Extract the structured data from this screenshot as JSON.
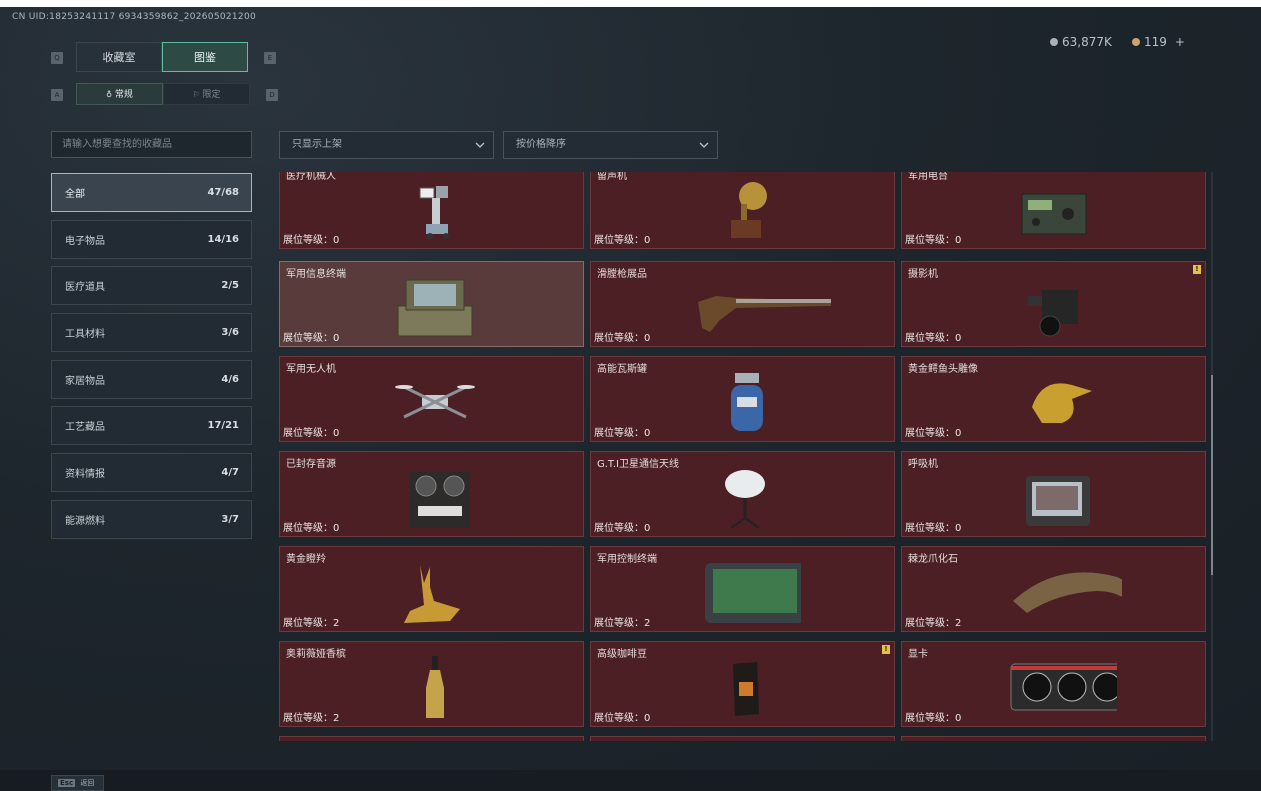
{
  "uid": "CN UID:18253241117 6934359862_202605021200",
  "currency": {
    "coins": "63,877K",
    "tokens": "119",
    "tokens_add": "+"
  },
  "keys": {
    "q": "Q",
    "e": "E",
    "a": "A",
    "d": "D"
  },
  "tabs": [
    "收藏室",
    "图鉴"
  ],
  "subtabs": [
    "常规",
    "限定"
  ],
  "search": {
    "placeholder": "请输入想要查找的收藏品"
  },
  "filters": {
    "shelf": "只显示上架",
    "sort": "按价格降序"
  },
  "categories": [
    {
      "label": "全部",
      "count": "47/68"
    },
    {
      "label": "电子物品",
      "count": "14/16"
    },
    {
      "label": "医疗道具",
      "count": "2/5"
    },
    {
      "label": "工具材料",
      "count": "3/6"
    },
    {
      "label": "家居物品",
      "count": "4/6"
    },
    {
      "label": "工艺藏品",
      "count": "17/21"
    },
    {
      "label": "资料情报",
      "count": "4/7"
    },
    {
      "label": "能源燃料",
      "count": "3/7"
    }
  ],
  "items": [
    {
      "name": "医疗机械人",
      "level": "展位等级：0",
      "icon": "medical-robot-icon"
    },
    {
      "name": "留声机",
      "level": "展位等级：0",
      "icon": "gramophone-icon"
    },
    {
      "name": "军用电台",
      "level": "展位等级：0",
      "icon": "radio-icon"
    },
    {
      "name": "军用信息终端",
      "level": "展位等级：0",
      "icon": "terminal-case-icon"
    },
    {
      "name": "滑膛枪展品",
      "level": "展位等级：0",
      "icon": "musket-icon"
    },
    {
      "name": "摄影机",
      "level": "展位等级：0",
      "icon": "camera-icon"
    },
    {
      "name": "军用无人机",
      "level": "展位等级：0",
      "icon": "drone-icon"
    },
    {
      "name": "高能瓦斯罐",
      "level": "展位等级：0",
      "icon": "gas-canister-icon"
    },
    {
      "name": "黄金鳄鱼头雕像",
      "level": "展位等级：0",
      "icon": "croc-statue-icon"
    },
    {
      "name": "已封存音源",
      "level": "展位等级：0",
      "icon": "reel-recorder-icon"
    },
    {
      "name": "G.T.I卫星通信天线",
      "level": "展位等级：0",
      "icon": "satellite-dish-icon"
    },
    {
      "name": "呼吸机",
      "level": "展位等级：0",
      "icon": "ventilator-icon"
    },
    {
      "name": "黄金瞪羚",
      "level": "展位等级：2",
      "icon": "gazelle-icon"
    },
    {
      "name": "军用控制终端",
      "level": "展位等级：2",
      "icon": "control-terminal-icon"
    },
    {
      "name": "棘龙爪化石",
      "level": "展位等级：2",
      "icon": "claw-fossil-icon"
    },
    {
      "name": "奥莉薇娅香槟",
      "level": "展位等级：2",
      "icon": "champagne-icon"
    },
    {
      "name": "高级咖啡豆",
      "level": "展位等级：0",
      "icon": "coffee-bag-icon"
    },
    {
      "name": "显卡",
      "level": "展位等级：0",
      "icon": "gpu-icon"
    }
  ],
  "alerts": {
    "mark": "!"
  },
  "footer": {
    "esc_key": "Esc",
    "esc_label": "返回"
  },
  "colors": {
    "accent": "#5fbfa0",
    "card_bg": "#4b1f23",
    "alert": "#e3c24a"
  }
}
